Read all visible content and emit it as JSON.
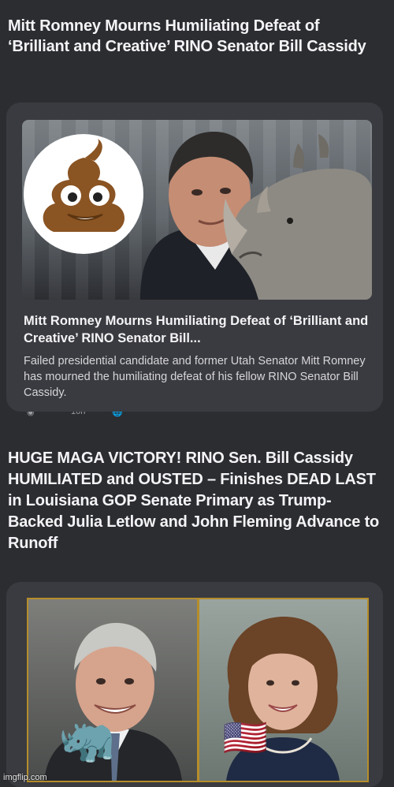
{
  "post1": {
    "title": "Mitt Romney Mourns Humiliating Defeat of ‘Brilliant and Creative’ RINO Senator Bill Cassidy",
    "card": {
      "headline": "Mitt Romney Mourns Humiliating Defeat of ‘Brilliant and Creative’ RINO Senator Bill...",
      "description": "Failed presidential candidate and former Utah Senator Mitt Romney has mourned the humiliating defeat of his fellow RINO Senator Bill Cassidy.",
      "thumbnail_elements": [
        "poop-emoji-icon",
        "romney-photo",
        "rhino-photo"
      ]
    }
  },
  "meta": {
    "time": "10h"
  },
  "post2": {
    "title": "HUGE MAGA VICTORY! RINO Sen. Bill Cassidy HUMILIATED and OUSTED – Finishes DEAD LAST in Louisiana GOP Senate Primary as Trump-Backed Julia Letlow and John Fleming Advance to Runoff",
    "card": {
      "photos": [
        "cassidy-portrait",
        "letlow-portrait"
      ],
      "overlays": [
        "rhino-emoji-icon",
        "us-flag-emoji-icon"
      ]
    }
  },
  "watermark": "imgflip.com",
  "colors": {
    "background": "#2c2d31",
    "card": "#3a3b40",
    "frame_gold": "#b58d2b"
  }
}
